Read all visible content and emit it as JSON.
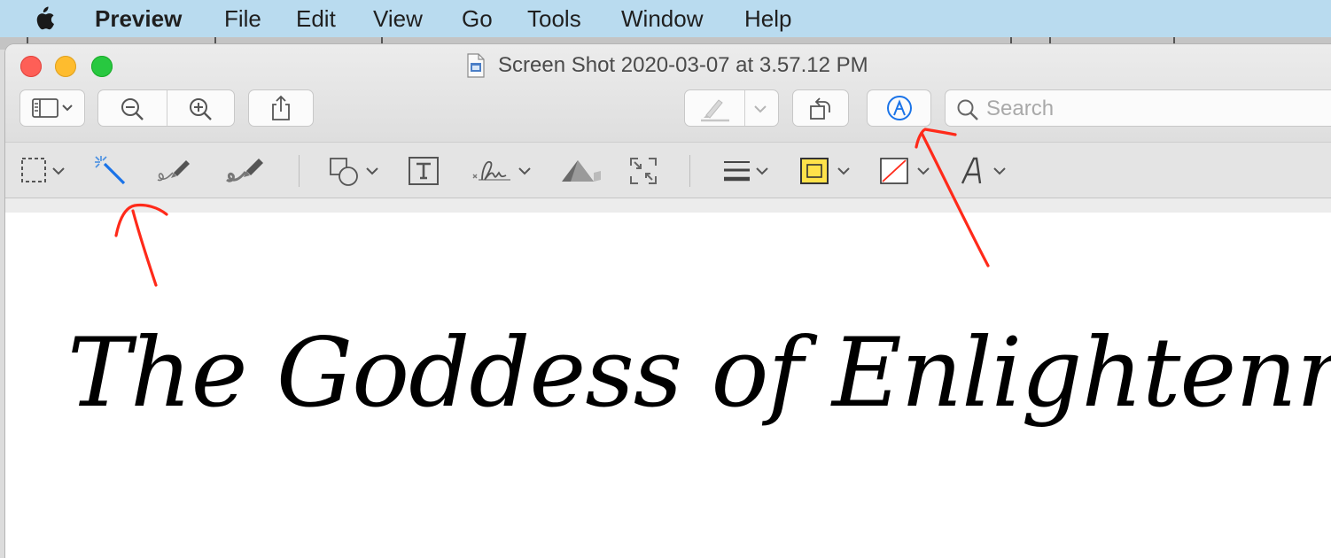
{
  "menubar": {
    "app_name": "Preview",
    "items": [
      "File",
      "Edit",
      "View",
      "Go",
      "Tools",
      "Window",
      "Help"
    ]
  },
  "window": {
    "title": "Screen Shot 2020-03-07 at 3.57.12 PM"
  },
  "toolbar": {
    "search_placeholder": "Search"
  },
  "document": {
    "text": "The Goddess of Enlightenment"
  },
  "colors": {
    "menubar_bg": "#b9dbef",
    "accent_blue": "#1a73e8",
    "annotation_red": "#ff2a1a",
    "highlight_yellow": "#ffe24a"
  },
  "icons": {
    "sidebar": "sidebar-icon",
    "zoom_out": "zoom-out-icon",
    "zoom_in": "zoom-in-icon",
    "share": "share-icon",
    "highlight": "highlighter-icon",
    "rotate": "rotate-icon",
    "markup": "markup-icon",
    "search": "search-icon"
  }
}
